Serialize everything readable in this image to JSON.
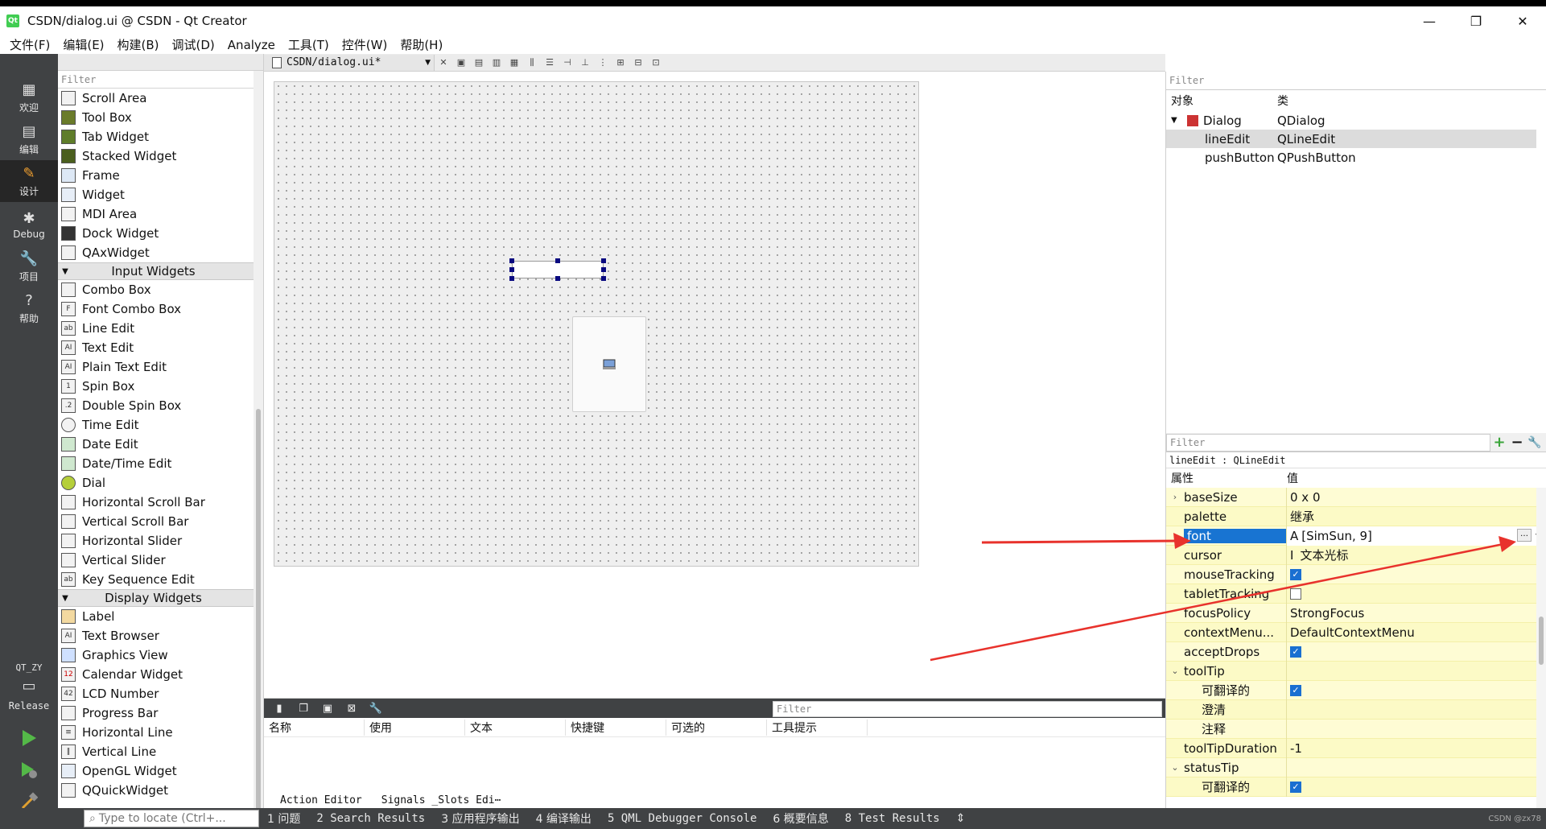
{
  "window": {
    "title": "CSDN/dialog.ui @ CSDN - Qt Creator",
    "logo": "Qt"
  },
  "menubar": [
    "文件(F)",
    "编辑(E)",
    "构建(B)",
    "调试(D)",
    "Analyze",
    "工具(T)",
    "控件(W)",
    "帮助(H)"
  ],
  "modes": {
    "welcome": "欢迎",
    "edit": "编辑",
    "design": "设计",
    "debug": "Debug",
    "projects": "项目",
    "help": "帮助"
  },
  "kit": {
    "project": "QT_ZY",
    "config": "Release"
  },
  "widget_box": {
    "filter_placeholder": "Filter",
    "containers": [
      "Scroll Area",
      "Tool Box",
      "Tab Widget",
      "Stacked Widget",
      "Frame",
      "Widget",
      "MDI Area",
      "Dock Widget",
      "QAxWidget"
    ],
    "input_category": "Input Widgets",
    "inputs": [
      "Combo Box",
      "Font Combo Box",
      "Line Edit",
      "Text Edit",
      "Plain Text Edit",
      "Spin Box",
      "Double Spin Box",
      "Time Edit",
      "Date Edit",
      "Date/Time Edit",
      "Dial",
      "Horizontal Scroll Bar",
      "Vertical Scroll Bar",
      "Horizontal Slider",
      "Vertical Slider",
      "Key Sequence Edit"
    ],
    "display_category": "Display Widgets",
    "displays": [
      "Label",
      "Text Browser",
      "Graphics View",
      "Calendar Widget",
      "LCD Number",
      "Progress Bar",
      "Horizontal Line",
      "Vertical Line",
      "OpenGL Widget",
      "QQuickWidget"
    ]
  },
  "document": {
    "name": "CSDN/dialog.ui*"
  },
  "action_editor": {
    "filter_placeholder": "Filter",
    "columns": [
      "名称",
      "使用",
      "文本",
      "快捷键",
      "可选的",
      "工具提示"
    ],
    "tabs": [
      "Action Editor",
      "Signals _Slots Edi⋯"
    ]
  },
  "object_inspector": {
    "filter_placeholder": "Filter",
    "headers": [
      "对象",
      "类"
    ],
    "rows": [
      {
        "object": "Dialog",
        "class": "QDialog"
      },
      {
        "object": "lineEdit",
        "class": "QLineEdit"
      },
      {
        "object": "pushButton",
        "class": "QPushButton"
      }
    ]
  },
  "property_editor": {
    "filter_placeholder": "Filter",
    "object_class": "lineEdit : QLineEdit",
    "headers": [
      "属性",
      "值"
    ],
    "props": {
      "baseSize": "baseSize",
      "baseSize_v": "0 x 0",
      "palette": "palette",
      "palette_v": "继承",
      "font": "font",
      "font_v": "[SimSun, 9]",
      "cursor": "cursor",
      "cursor_v": "文本光标",
      "mouseTracking": "mouseTracking",
      "tabletTracking": "tabletTracking",
      "focusPolicy": "focusPolicy",
      "focusPolicy_v": "StrongFocus",
      "contextMenu": "contextMenu...",
      "contextMenu_v": "DefaultContextMenu",
      "acceptDrops": "acceptDrops",
      "toolTip": "toolTip",
      "translatable": "可翻译的",
      "disambiguation": "澄清",
      "comment": "注释",
      "toolTipDuration": "toolTipDuration",
      "toolTipDuration_v": "-1",
      "statusTip": "statusTip",
      "translatable2": "可翻译的"
    },
    "checks": {
      "mouseTracking": true,
      "tabletTracking": false,
      "acceptDrops": true,
      "toolTip_translatable": true,
      "statusTip_translatable": true
    }
  },
  "statusbar": {
    "locator_placeholder": "Type to locate (Ctrl+...",
    "panes": [
      "1 问题",
      "2 Search Results",
      "3 应用程序输出",
      "4 编译输出",
      "5 QML Debugger Console",
      "6 概要信息",
      "8 Test Results"
    ],
    "watermark": "CSDN @zx78"
  },
  "colors": {
    "modebar": "#404244",
    "arrow": "#e8322c",
    "selection": "#1874d2",
    "prop_bg": "#fefcd4"
  }
}
